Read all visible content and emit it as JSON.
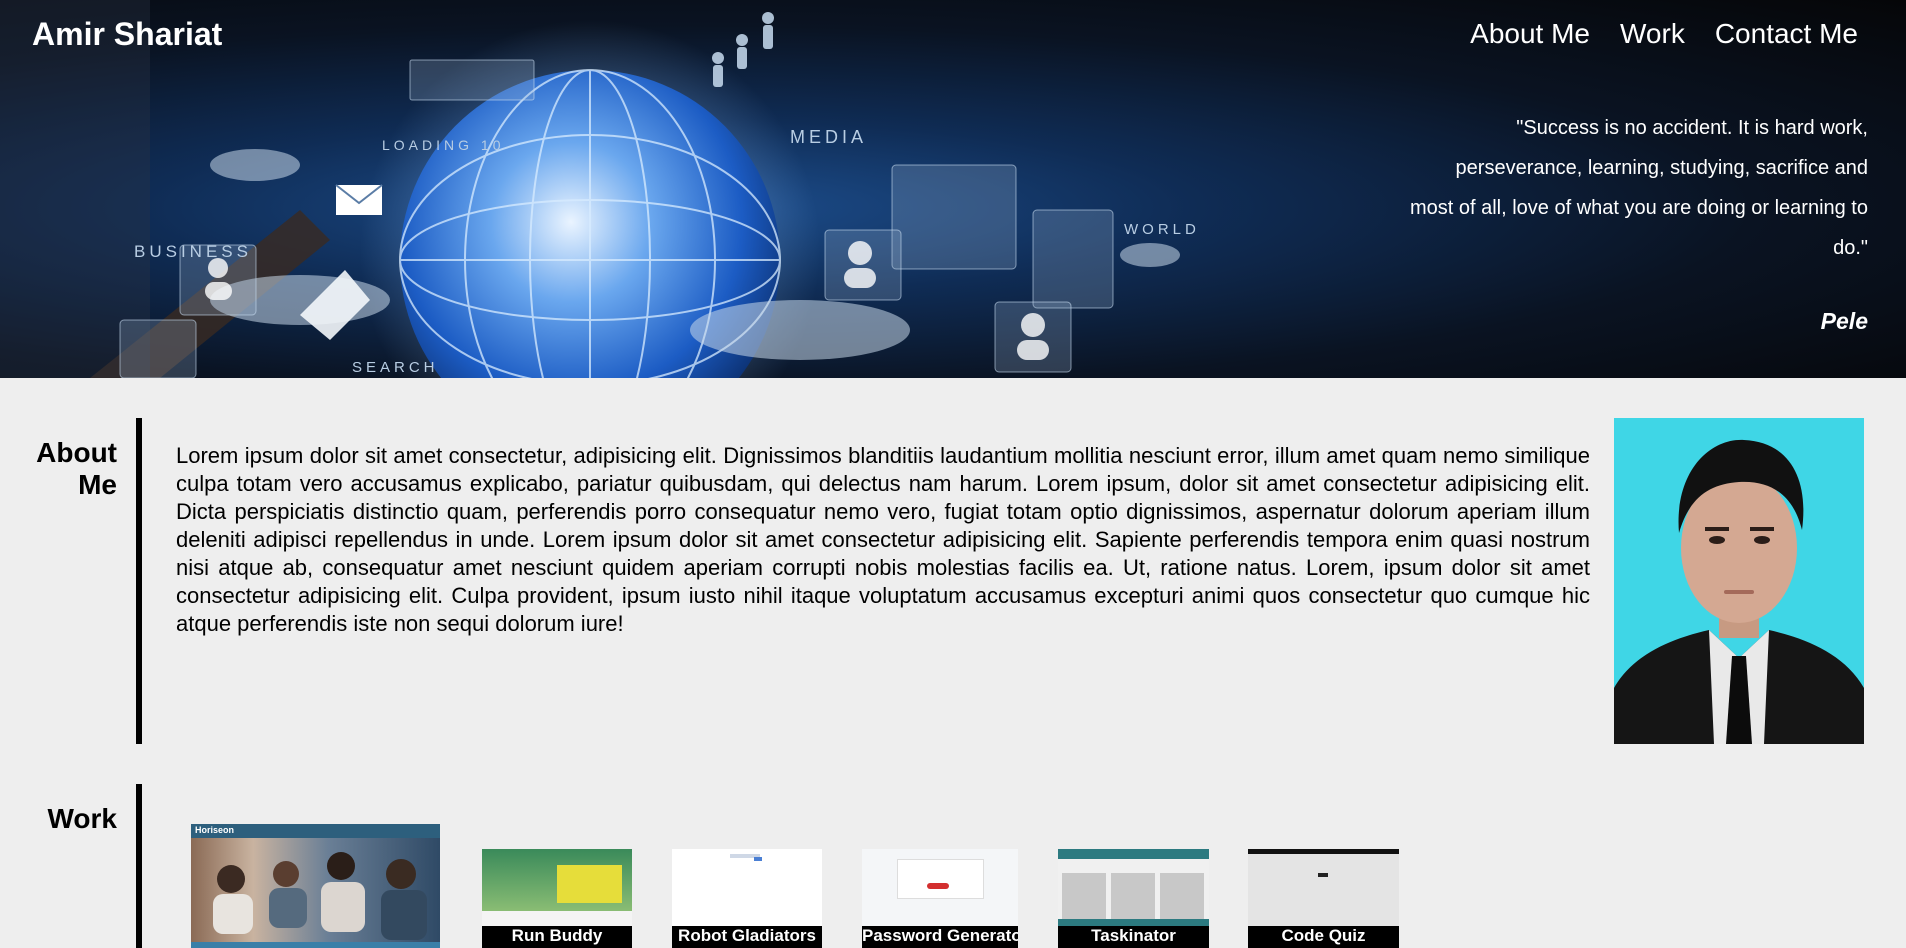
{
  "header": {
    "brand": "Amir Shariat",
    "nav": [
      "About Me",
      "Work",
      "Contact Me"
    ],
    "hero_words": {
      "loading": "LOADING 10",
      "media": "MEDIA",
      "business": "BUSINESS",
      "world": "WORLD",
      "search": "SEARCH"
    }
  },
  "quote": {
    "text": "\"Success is no accident. It is hard work, perseverance, learning, studying, sacrifice and most of all, love of what you are doing or learning to do.\"",
    "author": "Pele"
  },
  "about": {
    "title": "About Me",
    "body": "Lorem ipsum dolor sit amet consectetur, adipisicing elit. Dignissimos blanditiis laudantium mollitia nesciunt error, illum amet quam nemo similique culpa totam vero accusamus explicabo, pariatur quibusdam, qui delectus nam harum. Lorem ipsum, dolor sit amet consectetur adipisicing elit. Dicta perspiciatis distinctio quam, perferendis porro consequatur nemo vero, fugiat totam optio dignissimos, aspernatur dolorum aperiam illum deleniti adipisci repellendus in unde. Lorem ipsum dolor sit amet consectetur adipisicing elit. Sapiente perferendis tempora enim quasi nostrum nisi atque ab, consequatur amet nesciunt quidem aperiam corrupti nobis molestias facilis ea. Ut, ratione natus. Lorem, ipsum dolor sit amet consectetur adipisicing elit. Culpa provident, ipsum iusto nihil itaque voluptatum accusamus excepturi animi quos consectetur quo cumque hic atque perferendis iste non sequi dolorum iure!"
  },
  "work": {
    "title": "Work",
    "featured_thumb_brand": "Horiseon",
    "projects": [
      "Run Buddy",
      "Robot Gladiators",
      "Password Generator",
      "Taskinator",
      "Code Quiz"
    ]
  },
  "colors": {
    "accent_bar": "#000000",
    "portrait_bg": "#3fd6e6",
    "page_bg": "#eeeeee"
  }
}
